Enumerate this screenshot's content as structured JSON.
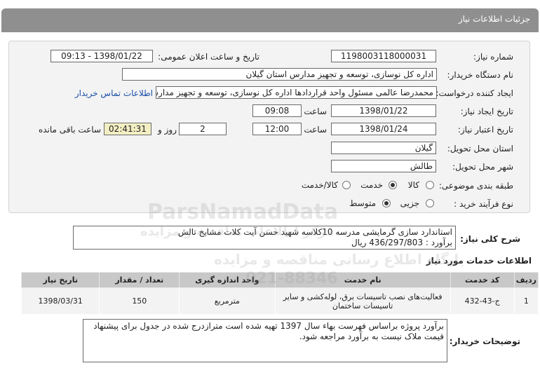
{
  "header": {
    "title": "جزئیات اطلاعات نیاز"
  },
  "fields": {
    "need_number_label": "شماره نیاز:",
    "need_number": "1198003118000031",
    "announce_label": "تاریخ و ساعت اعلان عمومی:",
    "announce_value": "1398/01/22 - 09:13",
    "buyer_org_label": "نام دستگاه خریدار:",
    "buyer_org": "اداره کل نوسازی، توسعه و تجهیز مدارس استان گیلان",
    "requester_label": "ایجاد کننده درخواست:",
    "requester": "محمدرضا عالمی مسئول واحد قراردادها اداره کل نوسازی، توسعه و تجهیز مدارس",
    "contact_link": "اطلاعات تماس خریدار",
    "created_label": "تاریخ ایجاد نیاز:",
    "created_date": "1398/01/22",
    "time_label": "ساعت",
    "created_time": "09:08",
    "validity_label": "تاریخ اعتبار نیاز:",
    "validity_date": "1398/01/24",
    "validity_time": "12:00",
    "days_value": "2",
    "days_label": "روز و",
    "remaining_time": "02:41:31",
    "remaining_label": "ساعت باقی مانده",
    "province_label": "استان محل تحویل:",
    "province": "گیلان",
    "city_label": "شهر محل تحویل:",
    "city": "طالش",
    "category_label": "طبقه بندی موضوعی:",
    "category_options": [
      "کالا",
      "خدمت",
      "کالا/خدمت"
    ],
    "purchase_label": "نوع فرآیند خرید :",
    "purchase_options": [
      "جزیی",
      "متوسط"
    ]
  },
  "description": {
    "label": "شرح کلی نیاز:",
    "line1": "استاندارد سازی گرمایشی مدرسه 10کلاسه شهید حسن آیت کلات مشایخ تالش",
    "line2": "برآورد : 436/297/803 ریال"
  },
  "services": {
    "section_title": "اطلاعات خدمات مورد نیاز",
    "headers": [
      "ردیف",
      "کد خدمت",
      "نام خدمت",
      "واحد اندازه گیری",
      "تعداد / مقدار",
      "تاریخ نیاز"
    ],
    "rows": [
      {
        "index": "1",
        "code": "ج-43-432",
        "name": "فعالیت‌های نصب تاسیسات برق، لوله‌کشی و سایر تاسیسات ساختمان",
        "unit": "مترمربع",
        "qty": "150",
        "date": "1398/03/31"
      }
    ]
  },
  "buyer_notes": {
    "label": "توضیحات خریدار:",
    "text": "برآورد پروژه براساس فهرست بهاء سال 1397 تهیه شده است متر‌ازدرج شده در جدول برای پیشنهاد قیمت ملاک نیست به برآورد مراجعه شود."
  },
  "watermark": {
    "brand": "ParsNamadData",
    "fa_line1": "پایگاه اطلاع رسانی مناقصه و مزایده",
    "fa_line2": "مرکز اطلاعات مناقصه و مزایده",
    "phone": "021-88346"
  }
}
